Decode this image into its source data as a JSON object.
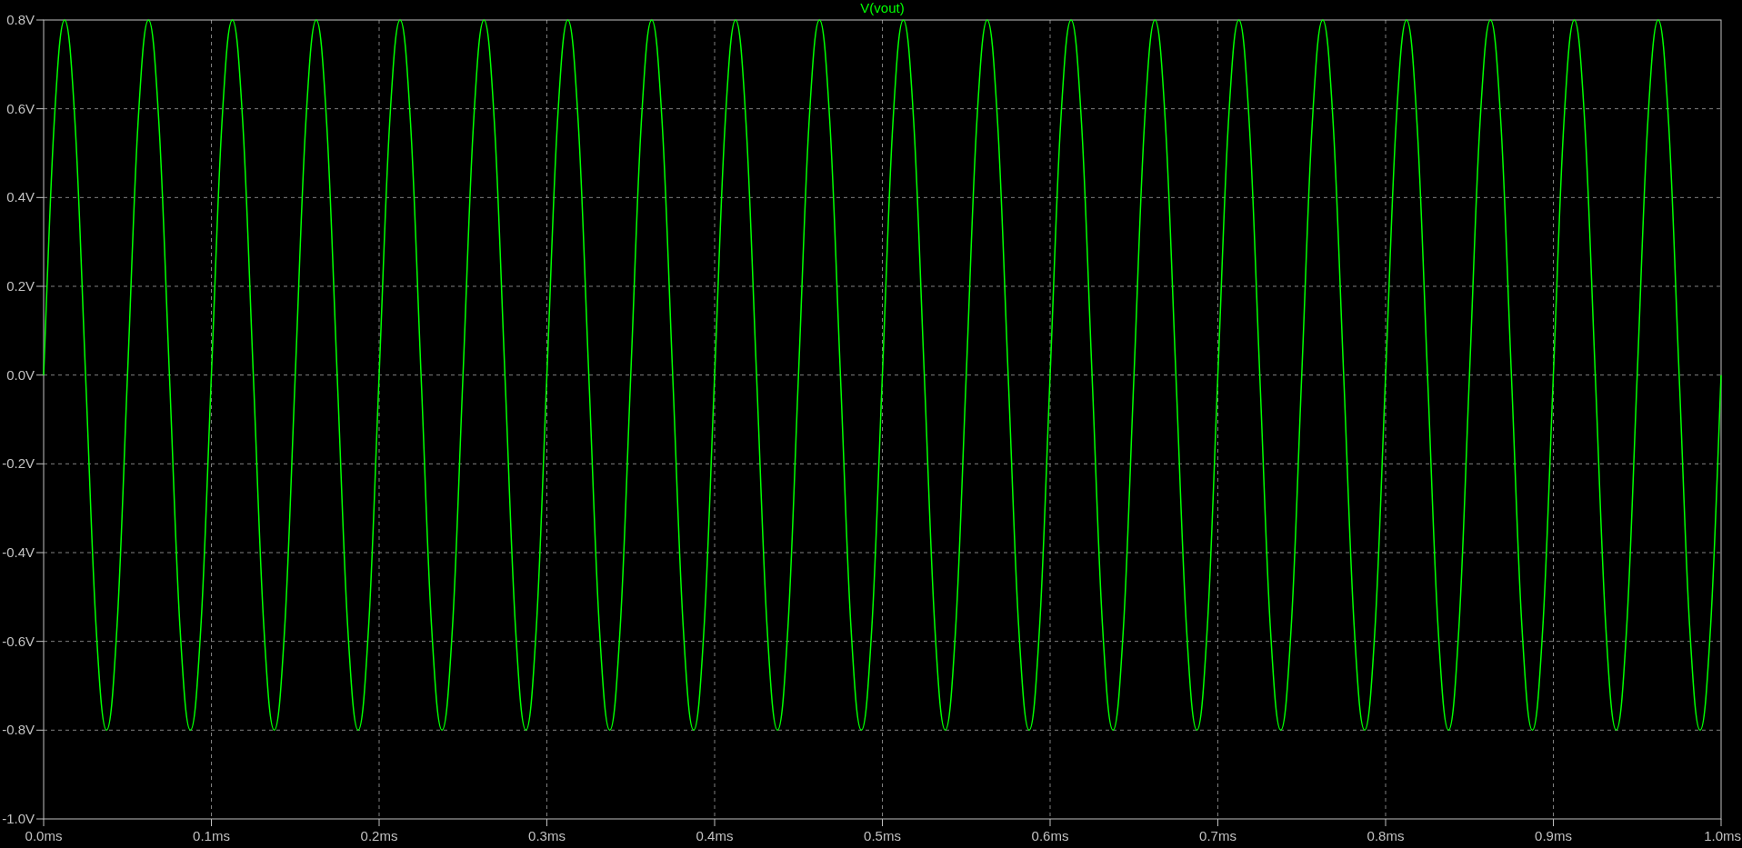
{
  "plot": {
    "chart_data": {
      "type": "line",
      "grid": true,
      "xlim": [
        0,
        1
      ],
      "ylim": [
        -1,
        0.8
      ],
      "xticks": [
        {
          "value": 0,
          "label": "0.0ms"
        },
        {
          "value": 0.1,
          "label": "0.1ms"
        },
        {
          "value": 0.2,
          "label": "0.2ms"
        },
        {
          "value": 0.3,
          "label": "0.3ms"
        },
        {
          "value": 0.4,
          "label": "0.4ms"
        },
        {
          "value": 0.5,
          "label": "0.5ms"
        },
        {
          "value": 0.6,
          "label": "0.6ms"
        },
        {
          "value": 0.7,
          "label": "0.7ms"
        },
        {
          "value": 0.8,
          "label": "0.8ms"
        },
        {
          "value": 0.9,
          "label": "0.9ms"
        },
        {
          "value": 1,
          "label": "1.0ms"
        }
      ],
      "yticks": [
        {
          "value": 0.8,
          "label": "0.8V"
        },
        {
          "value": 0.6,
          "label": "0.6V"
        },
        {
          "value": 0.4,
          "label": "0.4V"
        },
        {
          "value": 0.2,
          "label": "0.2V"
        },
        {
          "value": 0,
          "label": "0.0V"
        },
        {
          "value": -0.2,
          "label": "-0.2V"
        },
        {
          "value": -0.4,
          "label": "-0.4V"
        },
        {
          "value": -0.6,
          "label": "-0.6V"
        },
        {
          "value": -0.8,
          "label": "-0.8V"
        },
        {
          "value": -1,
          "label": "-1.0V"
        }
      ],
      "x": [
        0,
        0.00625,
        0.0125,
        0.01875,
        0.025,
        0.03125,
        0.0375,
        0.04375,
        0.05,
        0.05625,
        0.0625,
        0.06875,
        0.075,
        0.08125,
        0.0875,
        0.09375,
        0.1,
        0.10625,
        0.1125,
        0.11875,
        0.125,
        0.13125,
        0.1375,
        0.14375,
        0.15,
        0.15625,
        0.1625,
        0.16875,
        0.175,
        0.18125,
        0.1875,
        0.19375,
        0.2,
        0.20625,
        0.2125,
        0.21875,
        0.225,
        0.23125,
        0.2375,
        0.24375,
        0.25,
        0.25625,
        0.2625,
        0.26875,
        0.275,
        0.28125,
        0.2875,
        0.29375,
        0.3,
        0.30625,
        0.3125,
        0.31875,
        0.325,
        0.33125,
        0.3375,
        0.34375,
        0.35,
        0.35625,
        0.3625,
        0.36875,
        0.375,
        0.38125,
        0.3875,
        0.39375,
        0.4,
        0.40625,
        0.4125,
        0.41875,
        0.425,
        0.43125,
        0.4375,
        0.44375,
        0.45,
        0.45625,
        0.4625,
        0.46875,
        0.475,
        0.48125,
        0.4875,
        0.49375,
        0.5,
        0.50625,
        0.5125,
        0.51875,
        0.525,
        0.53125,
        0.5375,
        0.54375,
        0.55,
        0.55625,
        0.5625,
        0.56875,
        0.575,
        0.58125,
        0.5875,
        0.59375,
        0.6,
        0.60625,
        0.6125,
        0.61875,
        0.625,
        0.63125,
        0.6375,
        0.64375,
        0.65,
        0.65625,
        0.6625,
        0.66875,
        0.675,
        0.68125,
        0.6875,
        0.69375,
        0.7,
        0.70625,
        0.7125,
        0.71875,
        0.725,
        0.73125,
        0.7375,
        0.74375,
        0.75,
        0.75625,
        0.7625,
        0.76875,
        0.775,
        0.78125,
        0.7875,
        0.79375,
        0.8,
        0.80625,
        0.8125,
        0.81875,
        0.825,
        0.83125,
        0.8375,
        0.84375,
        0.85,
        0.85625,
        0.8625,
        0.86875,
        0.875,
        0.88125,
        0.8875,
        0.89375,
        0.9,
        0.90625,
        0.9125,
        0.91875,
        0.925,
        0.93125,
        0.9375,
        0.94375,
        0.95,
        0.95625,
        0.9625,
        0.96875,
        0.975,
        0.98125,
        0.9875,
        0.99375,
        1
      ],
      "series": [
        {
          "name": "V(vout)",
          "color": "#00ff00",
          "values": [
            0,
            0.566,
            0.8,
            0.566,
            0,
            -0.566,
            -0.8,
            -0.566,
            0,
            0.566,
            0.8,
            0.566,
            0,
            -0.566,
            -0.8,
            -0.566,
            0,
            0.566,
            0.8,
            0.566,
            0,
            -0.566,
            -0.8,
            -0.566,
            0,
            0.566,
            0.8,
            0.566,
            0,
            -0.566,
            -0.8,
            -0.566,
            0,
            0.566,
            0.8,
            0.566,
            0,
            -0.566,
            -0.8,
            -0.566,
            0,
            0.566,
            0.8,
            0.566,
            0,
            -0.566,
            -0.8,
            -0.566,
            0,
            0.566,
            0.8,
            0.566,
            0,
            -0.566,
            -0.8,
            -0.566,
            0,
            0.566,
            0.8,
            0.566,
            0,
            -0.566,
            -0.8,
            -0.566,
            0,
            0.566,
            0.8,
            0.566,
            0,
            -0.566,
            -0.8,
            -0.566,
            0,
            0.566,
            0.8,
            0.566,
            0,
            -0.566,
            -0.8,
            -0.566,
            0,
            0.566,
            0.8,
            0.566,
            0,
            -0.566,
            -0.8,
            -0.566,
            0,
            0.566,
            0.8,
            0.566,
            0,
            -0.566,
            -0.8,
            -0.566,
            0,
            0.566,
            0.8,
            0.566,
            0,
            -0.566,
            -0.8,
            -0.566,
            0,
            0.566,
            0.8,
            0.566,
            0,
            -0.566,
            -0.8,
            -0.566,
            0,
            0.566,
            0.8,
            0.566,
            0,
            -0.566,
            -0.8,
            -0.566,
            0,
            0.566,
            0.8,
            0.566,
            0,
            -0.566,
            -0.8,
            -0.566,
            0,
            0.566,
            0.8,
            0.566,
            0,
            -0.566,
            -0.8,
            -0.566,
            0,
            0.566,
            0.8,
            0.566,
            0,
            -0.566,
            -0.8,
            -0.566,
            0,
            0.566,
            0.8,
            0.566,
            0,
            -0.566,
            -0.8,
            -0.566,
            0,
            0.566,
            0.8,
            0.566,
            0,
            -0.566,
            -0.8,
            -0.566,
            0
          ]
        }
      ]
    }
  }
}
